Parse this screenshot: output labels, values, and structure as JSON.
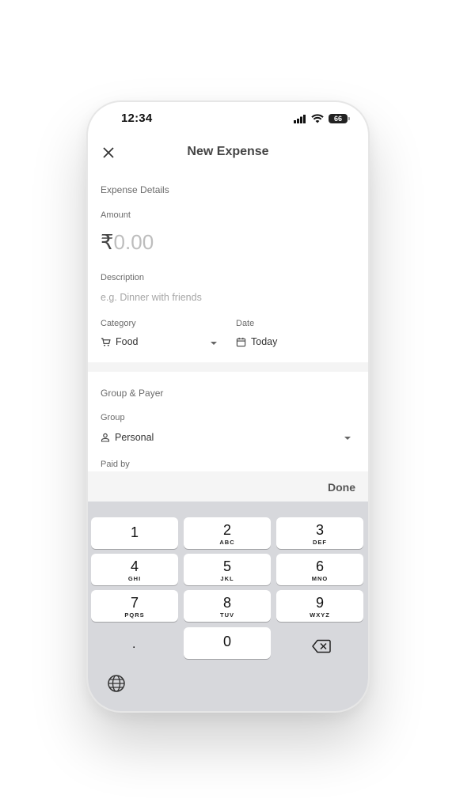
{
  "status_bar": {
    "time": "12:34",
    "battery": "66"
  },
  "header": {
    "title": "New Expense"
  },
  "expense_details": {
    "section_title": "Expense Details",
    "amount_label": "Amount",
    "currency_symbol": "₹",
    "amount_placeholder": "0.00",
    "description_label": "Description",
    "description_placeholder": "e.g. Dinner with friends",
    "category_label": "Category",
    "category_value": "Food",
    "date_label": "Date",
    "date_value": "Today"
  },
  "group_payer": {
    "section_title": "Group & Payer",
    "group_label": "Group",
    "group_value": "Personal",
    "paid_by_label": "Paid by"
  },
  "keyboard": {
    "done_label": "Done",
    "keys": [
      {
        "num": "1",
        "letters": ""
      },
      {
        "num": "2",
        "letters": "ABC"
      },
      {
        "num": "3",
        "letters": "DEF"
      },
      {
        "num": "4",
        "letters": "GHI"
      },
      {
        "num": "5",
        "letters": "JKL"
      },
      {
        "num": "6",
        "letters": "MNO"
      },
      {
        "num": "7",
        "letters": "PQRS"
      },
      {
        "num": "8",
        "letters": "TUV"
      },
      {
        "num": "9",
        "letters": "WXYZ"
      },
      {
        "num": "0",
        "letters": ""
      }
    ],
    "decimal": "."
  }
}
